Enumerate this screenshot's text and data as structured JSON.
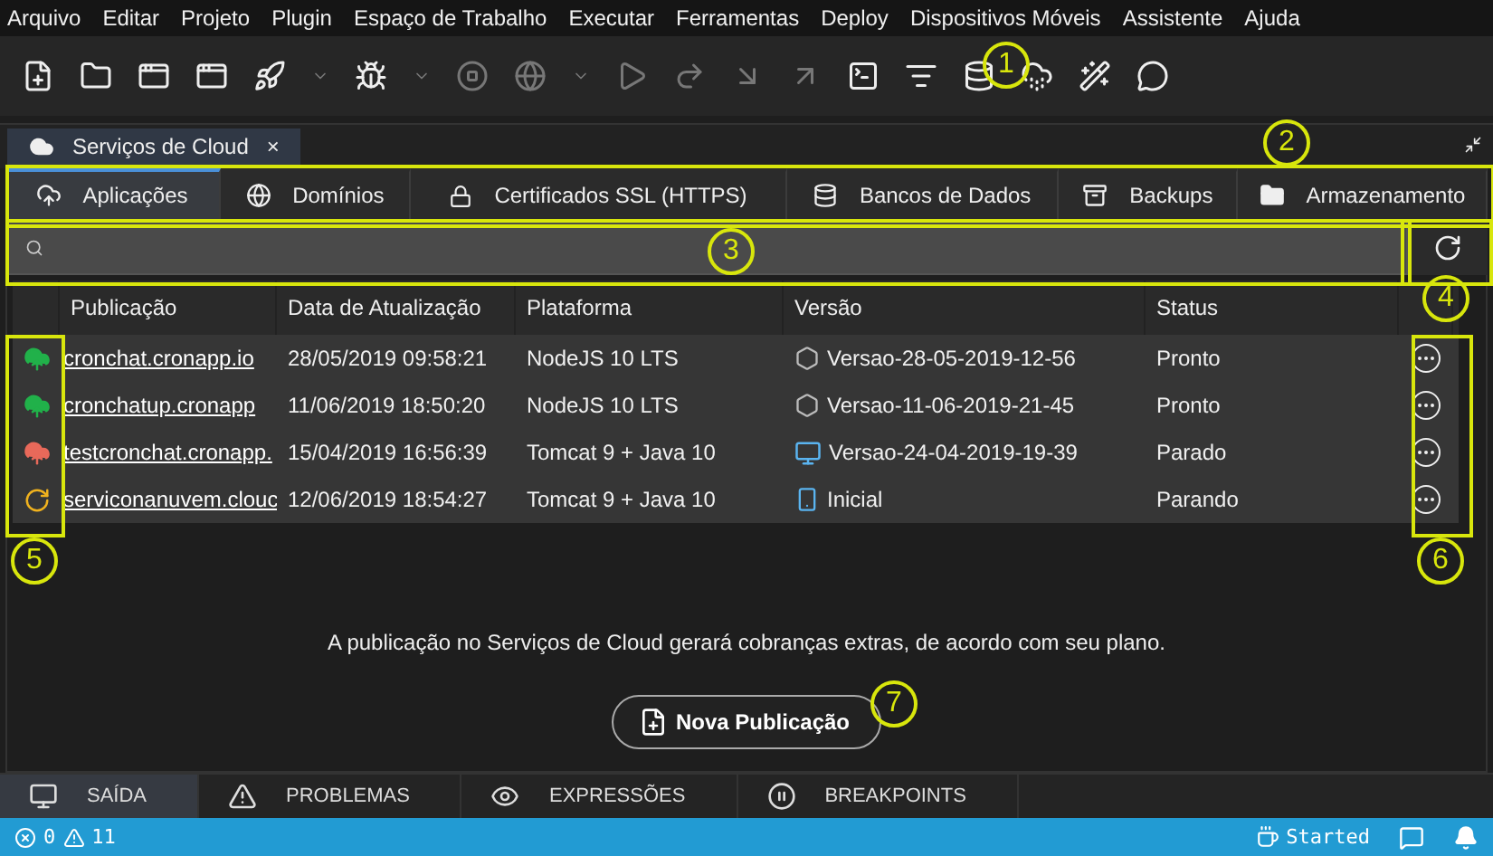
{
  "menu": [
    "Arquivo",
    "Editar",
    "Projeto",
    "Plugin",
    "Espaço de Trabalho",
    "Executar",
    "Ferramentas",
    "Deploy",
    "Dispositivos Móveis",
    "Assistente",
    "Ajuda"
  ],
  "editor_tab": {
    "title": "Serviços de Cloud",
    "close": "×"
  },
  "tabs": [
    {
      "label": "Aplicações",
      "kind": "cloud",
      "selected": true
    },
    {
      "label": "Domínios",
      "kind": "globe",
      "selected": false
    },
    {
      "label": "Certificados SSL (HTTPS)",
      "kind": "lock",
      "selected": false
    },
    {
      "label": "Bancos de Dados",
      "kind": "database",
      "selected": false
    },
    {
      "label": "Backups",
      "kind": "safe",
      "selected": false
    },
    {
      "label": "Armazenamento",
      "kind": "folder",
      "selected": false
    }
  ],
  "table": {
    "columns": [
      "Publicação",
      "Data de Atualização",
      "Plataforma",
      "Versão",
      "Status"
    ],
    "rows": [
      {
        "kind": "cloud",
        "color": "#21b14a",
        "publication": "cronchat.cronapp.io",
        "updated": "28/05/2019 09:58:21",
        "platform": "NodeJS 10 LTS",
        "version": {
          "kind": "nodejs",
          "text": "Versao-28-05-2019-12-56"
        },
        "status": "Pronto"
      },
      {
        "kind": "cloud",
        "color": "#21b14a",
        "publication": "cronchatup.cronapp",
        "updated": "11/06/2019 18:50:20",
        "platform": "NodeJS 10 LTS",
        "version": {
          "kind": "nodejs",
          "text": "Versao-11-06-2019-21-45"
        },
        "status": "Pronto"
      },
      {
        "kind": "cloud",
        "color": "#e8695a",
        "publication": "testcronchat.cronapp.",
        "updated": "15/04/2019 16:56:39",
        "platform": "Tomcat 9 + Java 10",
        "version": {
          "kind": "monitor",
          "text": "Versao-24-04-2019-19-39"
        },
        "status": "Parado"
      },
      {
        "kind": "spinner",
        "color": "#f0b21e",
        "publication": "serviconanuvem.clouc",
        "updated": "12/06/2019 18:54:27",
        "platform": "Tomcat 9 + Java 10",
        "version": {
          "kind": "phone",
          "text": "Inicial"
        },
        "status": "Parando"
      }
    ]
  },
  "notice": "A publicação no Serviços de Cloud gerará cobranças extras, de acordo com seu plano.",
  "new_button": "Nova Publicação",
  "bottom_tabs": [
    {
      "label": "SAÍDA",
      "kind": "monitor",
      "selected": true
    },
    {
      "label": "PROBLEMAS",
      "kind": "warning",
      "selected": false
    },
    {
      "label": "EXPRESSÕES",
      "kind": "eye",
      "selected": false
    },
    {
      "label": "BREAKPOINTS",
      "kind": "pause",
      "selected": false
    }
  ],
  "status_bar": {
    "errors": "0",
    "warnings": "11",
    "server": "Started"
  },
  "callouts": [
    "1",
    "2",
    "3",
    "4",
    "5",
    "6",
    "7"
  ]
}
